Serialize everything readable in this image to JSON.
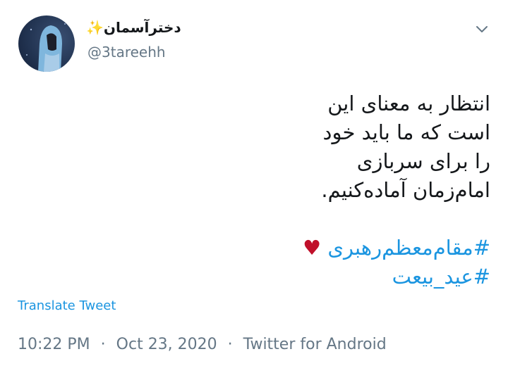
{
  "user": {
    "display_name": "دخترآسمان✨",
    "handle": "@3tareehh"
  },
  "tweet": {
    "lines": [
      "انتظار به معنای این",
      "است که ما باید خود",
      "را برای سربازی",
      "امام‌زمان آماده‌کنیم."
    ],
    "hashtags": [
      "#مقام‌معظم‌رهبری",
      "#عید_بیعت"
    ],
    "heart_emoji": "♥"
  },
  "translate_label": "Translate Tweet",
  "meta": {
    "time": "10:22 PM",
    "date": "Oct 23, 2020",
    "source": "Twitter for Android",
    "separator": "·"
  },
  "icons": {
    "menu": "chevron-down-icon"
  },
  "colors": {
    "link": "#1b95e0",
    "secondary_text": "#657786",
    "heart": "#c0102a"
  }
}
